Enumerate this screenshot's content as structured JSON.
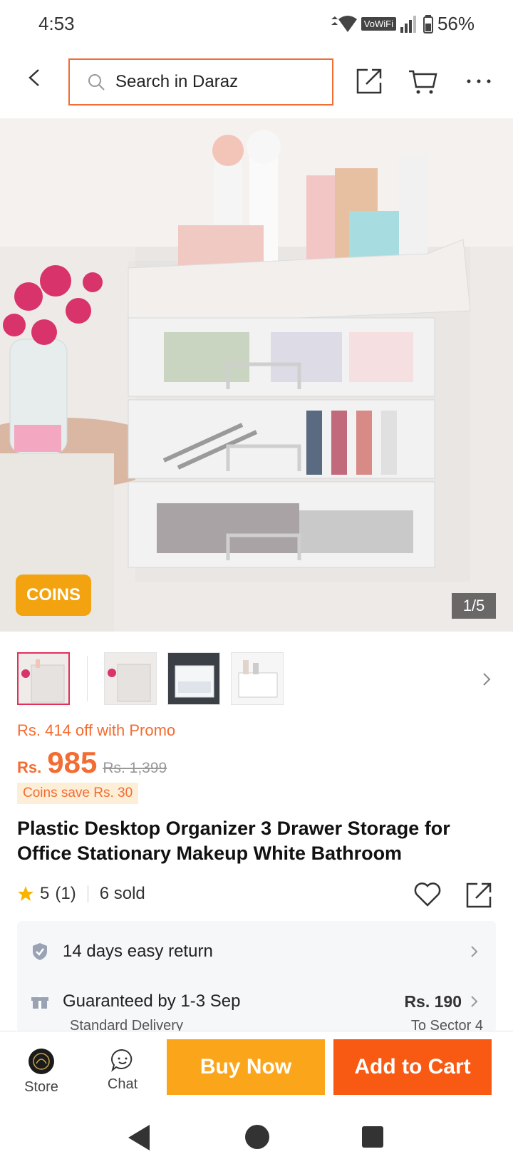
{
  "status_bar": {
    "time": "4:53",
    "network_label": "VoWiFi",
    "battery": "56%"
  },
  "header": {
    "search_placeholder": "Search in Daraz"
  },
  "hero": {
    "coins_badge": "COINS",
    "page_indicator": "1/5"
  },
  "price": {
    "promo_text": "Rs. 414 off with Promo",
    "currency": "Rs.",
    "current": "985",
    "original": "Rs. 1,399",
    "coins_save": "Coins save Rs. 30"
  },
  "product": {
    "title": "Plastic Desktop Organizer 3 Drawer Storage for Office Stationary Makeup White Bathroom",
    "rating": "5",
    "review_count": "(1)",
    "sold": "6 sold"
  },
  "services": {
    "return_text": "14 days easy return",
    "delivery_text": "Guaranteed by 1-3 Sep",
    "delivery_type": "Standard Delivery",
    "delivery_price": "Rs. 190",
    "delivery_dest": "To Sector 4"
  },
  "bottom_bar": {
    "store_label": "Store",
    "chat_label": "Chat",
    "buy_now": "Buy Now",
    "add_to_cart": "Add to Cart"
  },
  "colors": {
    "accent": "#f36c31",
    "buy_now": "#fba51b",
    "add_to_cart": "#f85a14",
    "coins": "#f2a30f"
  }
}
